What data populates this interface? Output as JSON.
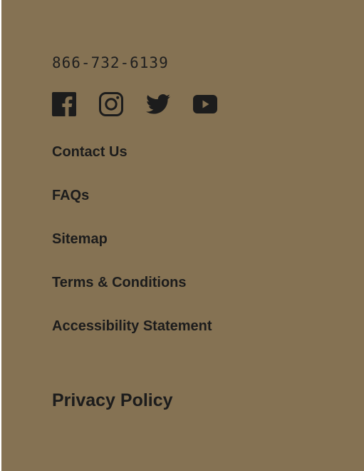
{
  "colors": {
    "background": "#857253",
    "text": "#1c1c1c"
  },
  "footer": {
    "phone": "866-732-6139",
    "social": [
      {
        "icon": "facebook-icon"
      },
      {
        "icon": "instagram-icon"
      },
      {
        "icon": "twitter-icon"
      },
      {
        "icon": "youtube-icon"
      }
    ],
    "links": [
      {
        "label": "Contact Us"
      },
      {
        "label": "FAQs"
      },
      {
        "label": "Sitemap"
      },
      {
        "label": "Terms & Conditions"
      },
      {
        "label": "Accessibility Statement"
      }
    ],
    "privacy_label": "Privacy Policy"
  }
}
